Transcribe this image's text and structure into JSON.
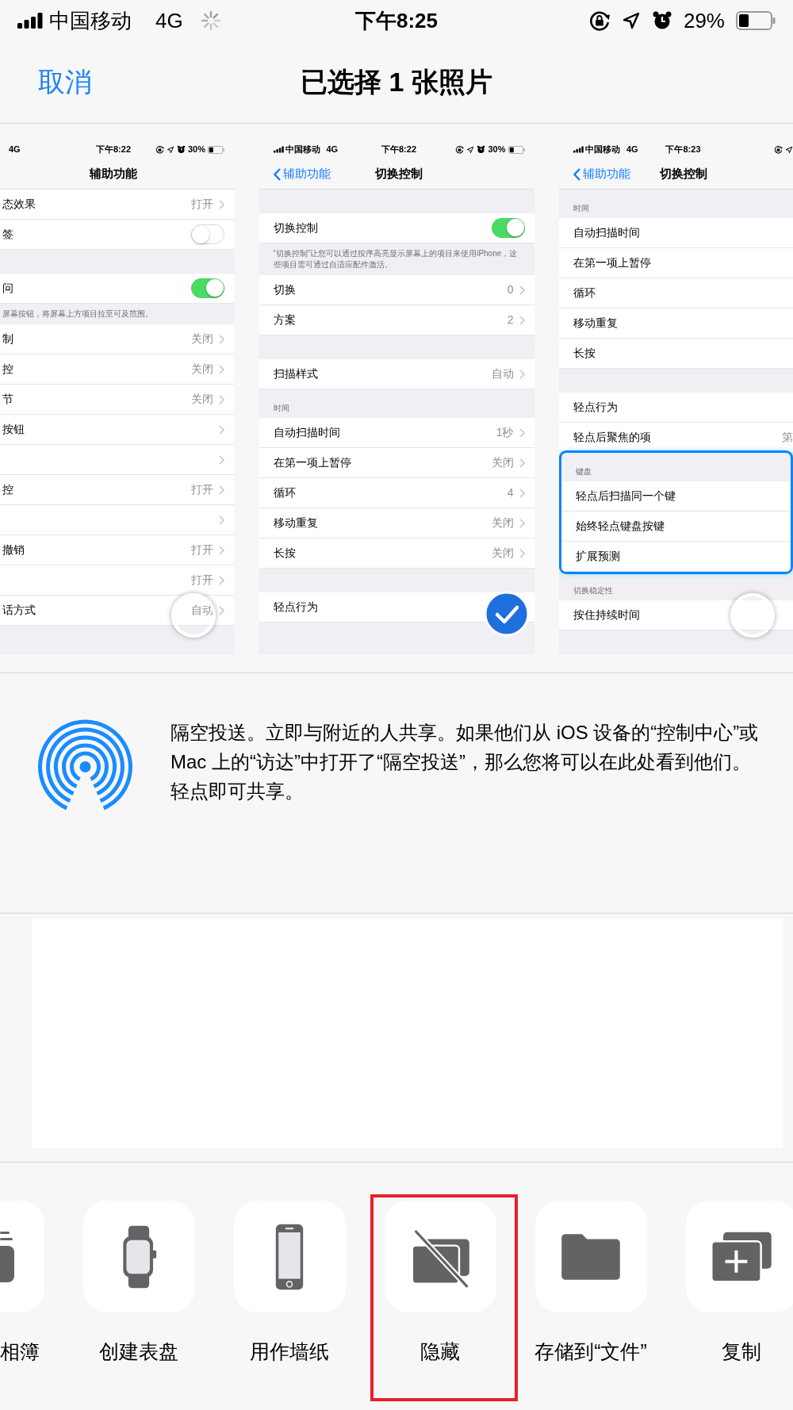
{
  "status_bar": {
    "carrier": "中国移动",
    "network": "4G",
    "time": "下午8:25",
    "battery": "29%"
  },
  "header": {
    "cancel": "取消",
    "title": "已选择 1 张照片"
  },
  "photos": [
    {
      "selected": false,
      "touch_button": true,
      "status": {
        "network": "4G",
        "time": "下午8:22",
        "battery": "30%"
      },
      "nav": {
        "title": "辅助功能"
      },
      "items": [
        {
          "kind": "row",
          "label": "态效果",
          "value": "打开",
          "chevron": true
        },
        {
          "kind": "toggle",
          "label": "签",
          "on": false
        },
        {
          "kind": "gap"
        },
        {
          "kind": "toggle",
          "label": "问",
          "on": true
        },
        {
          "kind": "note",
          "text": "屏幕按钮，将屏幕上方项目拉至可及范围。"
        },
        {
          "kind": "row",
          "label": "制",
          "value": "关闭",
          "chevron": true
        },
        {
          "kind": "row",
          "label": "控",
          "value": "关闭",
          "chevron": true
        },
        {
          "kind": "row",
          "label": "节",
          "value": "关闭",
          "chevron": true
        },
        {
          "kind": "row",
          "label": "按钮",
          "chevron": true
        },
        {
          "kind": "row",
          "chevron": true
        },
        {
          "kind": "row",
          "label": "控",
          "value": "打开",
          "chevron": true
        },
        {
          "kind": "row",
          "chevron": true
        },
        {
          "kind": "row",
          "label": "撤销",
          "value": "打开",
          "chevron": true
        },
        {
          "kind": "row",
          "value": "打开",
          "chevron": true
        },
        {
          "kind": "row",
          "label": "话方式",
          "value": "自动",
          "chevron": true
        }
      ]
    },
    {
      "selected": true,
      "touch_button": false,
      "status": {
        "carrier": "中国移动",
        "network": "4G",
        "time": "下午8:22",
        "battery": "30%"
      },
      "nav": {
        "back": "辅助功能",
        "title": "切换控制"
      },
      "items": [
        {
          "kind": "gap"
        },
        {
          "kind": "toggle",
          "label": "切换控制",
          "on": true
        },
        {
          "kind": "note",
          "text": "“切换控制”让您可以通过按序高亮显示屏幕上的项目来使用iPhone，这些项目需可通过自适应配件激活。"
        },
        {
          "kind": "row",
          "label": "切换",
          "value": "0",
          "chevron": true
        },
        {
          "kind": "row",
          "label": "方案",
          "value": "2",
          "chevron": true
        },
        {
          "kind": "gap"
        },
        {
          "kind": "row",
          "label": "扫描样式",
          "value": "自动",
          "chevron": true
        },
        {
          "kind": "header",
          "text": "时间"
        },
        {
          "kind": "row",
          "label": "自动扫描时间",
          "value": "1秒",
          "chevron": true
        },
        {
          "kind": "row",
          "label": "在第一项上暂停",
          "value": "关闭",
          "chevron": true
        },
        {
          "kind": "row",
          "label": "循环",
          "value": "4",
          "chevron": true
        },
        {
          "kind": "row",
          "label": "移动重复",
          "value": "关闭",
          "chevron": true
        },
        {
          "kind": "row",
          "label": "长按",
          "value": "关闭",
          "chevron": true
        },
        {
          "kind": "gap"
        },
        {
          "kind": "row",
          "label": "轻点行为",
          "chevron": false
        }
      ]
    },
    {
      "selected": false,
      "touch_button": true,
      "status": {
        "carrier": "中国移动",
        "network": "4G",
        "time": "下午8:23"
      },
      "nav": {
        "back": "辅助功能",
        "title": "切换控制"
      },
      "items": [
        {
          "kind": "header",
          "text": "时间"
        },
        {
          "kind": "row",
          "label": "自动扫描时间",
          "chevron": false
        },
        {
          "kind": "row",
          "label": "在第一项上暂停",
          "chevron": false
        },
        {
          "kind": "row",
          "label": "循环",
          "chevron": false
        },
        {
          "kind": "row",
          "label": "移动重复",
          "chevron": false
        },
        {
          "kind": "row",
          "label": "长按",
          "chevron": false
        },
        {
          "kind": "gap"
        },
        {
          "kind": "row",
          "label": "轻点行为",
          "chevron": false
        },
        {
          "kind": "row",
          "label": "轻点后聚焦的项",
          "value": "第",
          "chevron": false
        },
        {
          "kind": "group",
          "focused": true,
          "items": [
            {
              "kind": "header",
              "text": "键盘"
            },
            {
              "kind": "row",
              "label": "轻点后扫描同一个键",
              "chevron": false
            },
            {
              "kind": "row",
              "label": "始终轻点键盘按键",
              "chevron": false
            },
            {
              "kind": "row",
              "label": "扩展预测",
              "chevron": false
            }
          ]
        },
        {
          "kind": "header",
          "text": "切换稳定性"
        },
        {
          "kind": "row",
          "label": "按住持续时间",
          "chevron": false
        }
      ]
    }
  ],
  "airdrop": {
    "text": "隔空投送。立即与附近的人共享。如果他们从 iOS 设备的“控制中心”或 Mac 上的“访达”中打开了“隔空投送”，那么您将可以在此处看到他们。轻点即可共享。"
  },
  "actions": [
    {
      "kind": "album",
      "label": "相簿",
      "highlighted": false
    },
    {
      "kind": "watch",
      "label": "创建表盘",
      "highlighted": false
    },
    {
      "kind": "wallpaper",
      "label": "用作墙纸",
      "highlighted": false
    },
    {
      "kind": "hide",
      "label": "隐藏",
      "highlighted": true
    },
    {
      "kind": "files",
      "label": "存储到“文件”",
      "highlighted": false
    },
    {
      "kind": "duplicate",
      "label": "复制",
      "highlighted": false
    }
  ]
}
